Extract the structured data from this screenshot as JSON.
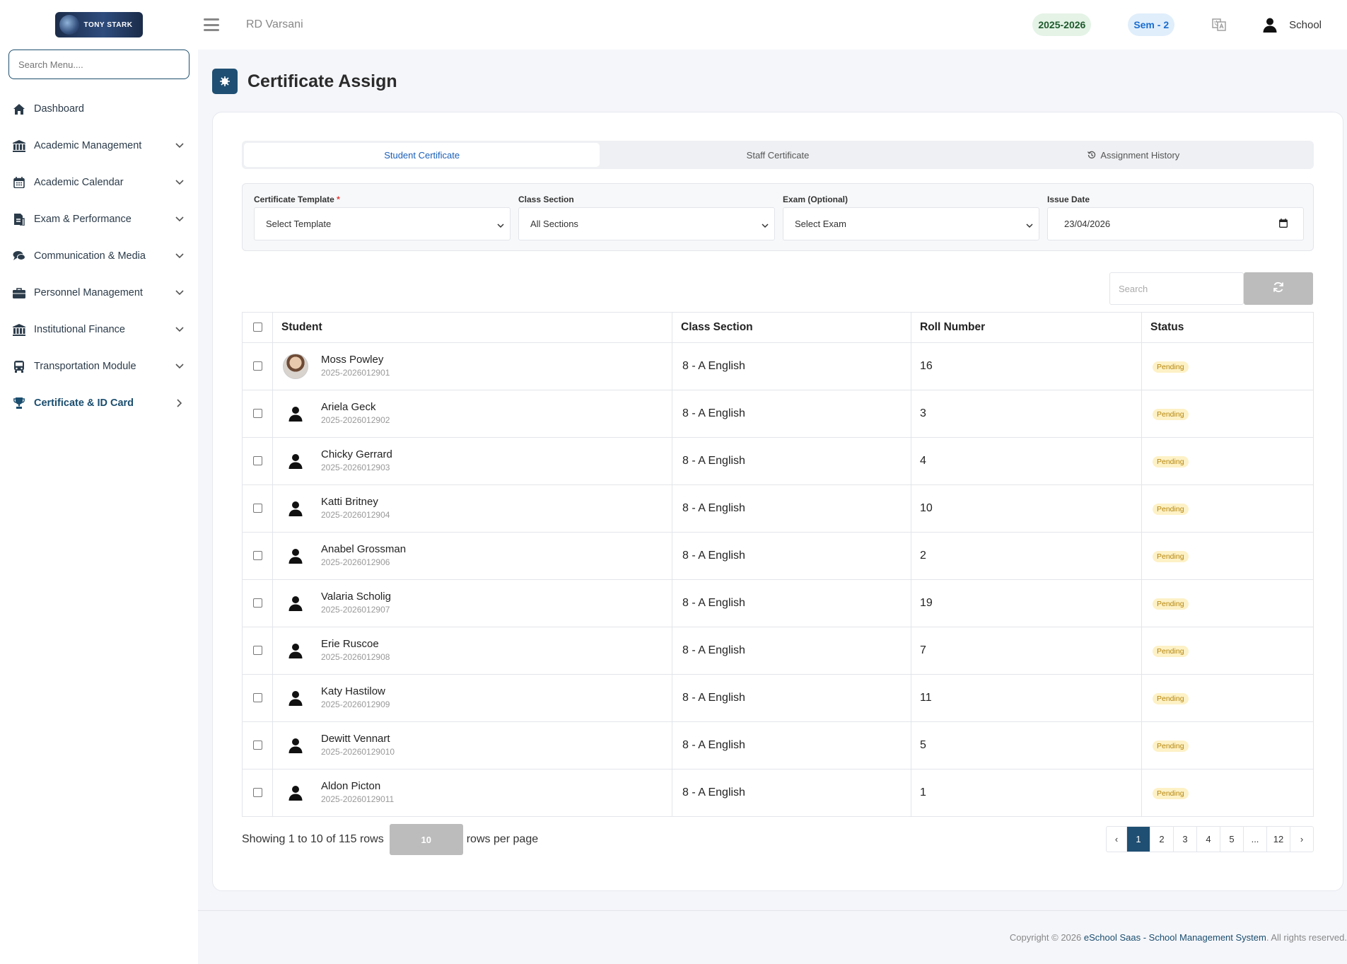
{
  "app": {
    "logo_text": "TONY STARK",
    "school_name": "RD Varsani"
  },
  "topbar": {
    "session": "2025-2026",
    "semester": "Sem - 2",
    "user": "School"
  },
  "sidebar": {
    "search_placeholder": "Search Menu....",
    "items": [
      {
        "label": "Dashboard",
        "icon": "home-icon"
      },
      {
        "label": "Academic Management",
        "icon": "university-icon"
      },
      {
        "label": "Academic Calendar",
        "icon": "calendar-icon"
      },
      {
        "label": "Exam & Performance",
        "icon": "exam-icon"
      },
      {
        "label": "Communication & Media",
        "icon": "chat-icon"
      },
      {
        "label": "Personnel Management",
        "icon": "briefcase-icon"
      },
      {
        "label": "Institutional Finance",
        "icon": "bank-icon"
      },
      {
        "label": "Transportation Module",
        "icon": "bus-icon"
      },
      {
        "label": "Certificate & ID Card",
        "icon": "trophy-icon",
        "active": true
      }
    ]
  },
  "page": {
    "title": "Certificate Assign"
  },
  "tabs": [
    "Student Certificate",
    "Staff Certificate",
    "Assignment History"
  ],
  "filters": {
    "template": {
      "label": "Certificate Template",
      "required_mark": "*",
      "value": "Select Template"
    },
    "class_section": {
      "label": "Class Section",
      "value": "All Sections"
    },
    "exam": {
      "label": "Exam (Optional)",
      "value": "Select Exam"
    },
    "issue_date": {
      "label": "Issue Date",
      "value": "23/04/2026"
    }
  },
  "table": {
    "search_placeholder": "Search",
    "columns": [
      "Student",
      "Class Section",
      "Roll Number",
      "Status"
    ],
    "rows": [
      {
        "name": "Moss Powley",
        "id": "2025-2026012901",
        "class": "8 - A English",
        "roll": "16",
        "status": "Pending"
      },
      {
        "name": "Ariela Geck",
        "id": "2025-2026012902",
        "class": "8 - A English",
        "roll": "3",
        "status": "Pending"
      },
      {
        "name": "Chicky Gerrard",
        "id": "2025-2026012903",
        "class": "8 - A English",
        "roll": "4",
        "status": "Pending"
      },
      {
        "name": "Katti Britney",
        "id": "2025-2026012904",
        "class": "8 - A English",
        "roll": "10",
        "status": "Pending"
      },
      {
        "name": "Anabel Grossman",
        "id": "2025-2026012906",
        "class": "8 - A English",
        "roll": "2",
        "status": "Pending"
      },
      {
        "name": "Valaria Scholig",
        "id": "2025-2026012907",
        "class": "8 - A English",
        "roll": "19",
        "status": "Pending"
      },
      {
        "name": "Erie Ruscoe",
        "id": "2025-2026012908",
        "class": "8 - A English",
        "roll": "7",
        "status": "Pending"
      },
      {
        "name": "Katy Hastilow",
        "id": "2025-2026012909",
        "class": "8 - A English",
        "roll": "11",
        "status": "Pending"
      },
      {
        "name": "Dewitt Vennart",
        "id": "2025-20260129010",
        "class": "8 - A English",
        "roll": "5",
        "status": "Pending"
      },
      {
        "name": "Aldon Picton",
        "id": "2025-20260129011",
        "class": "8 - A English",
        "roll": "1",
        "status": "Pending"
      }
    ]
  },
  "pagination": {
    "showing": "Showing 1 to 10 of 115 rows",
    "per_page": "10",
    "per_page_suffix": "rows per page",
    "pages": [
      "‹",
      "1",
      "2",
      "3",
      "4",
      "5",
      "...",
      "12",
      "›"
    ],
    "current": "1"
  },
  "footer": {
    "prefix": "Copyright © 2026 ",
    "link": "eSchool Saas - School Management System",
    "suffix": ". All rights reserved."
  },
  "colors": {
    "primary": "#1f4f72",
    "pending_bg": "#fdf1c6",
    "pending_text": "#b5860d"
  }
}
